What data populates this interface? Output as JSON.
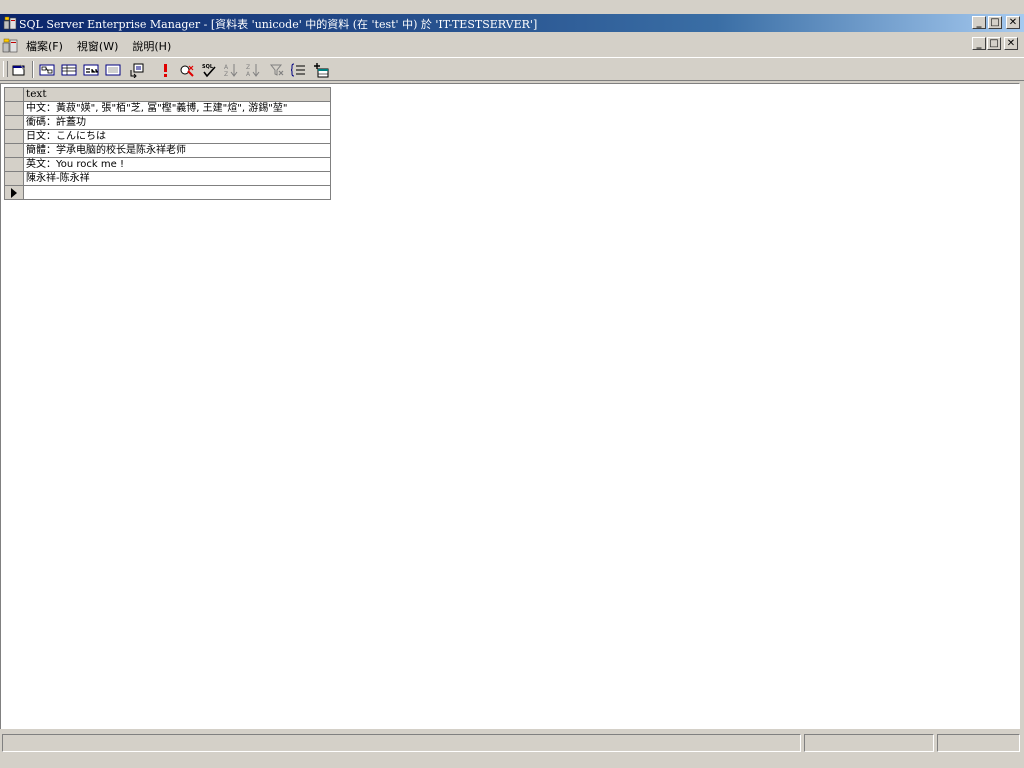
{
  "window": {
    "title": "SQL Server Enterprise Manager - [資料表 'unicode' 中的資料 (在 'test' 中) 於 'IT-TESTSERVER']"
  },
  "menubar": {
    "items": [
      {
        "label": "檔案(F)"
      },
      {
        "label": "視窗(W)"
      },
      {
        "label": "說明(H)"
      }
    ]
  },
  "grid": {
    "header": "text",
    "rows": [
      "中文：黃菽\"媖\", 張\"栢\"芝, 冨\"樫\"義博, 王建\"煊\", 游錫\"堃\"",
      "衝碼：許蓋功",
      "日文：こんにちは",
      "簡體：学承电脑的校长是陈永祥老师",
      "英文：You rock me !",
      "陳永祥-陈永祥"
    ]
  },
  "statusbar": {
    "panels": [
      "",
      "",
      ""
    ]
  },
  "colors": {
    "titlebar_start": "#0a246a",
    "titlebar_end": "#a6caf0",
    "chrome": "#d4d0c8"
  }
}
